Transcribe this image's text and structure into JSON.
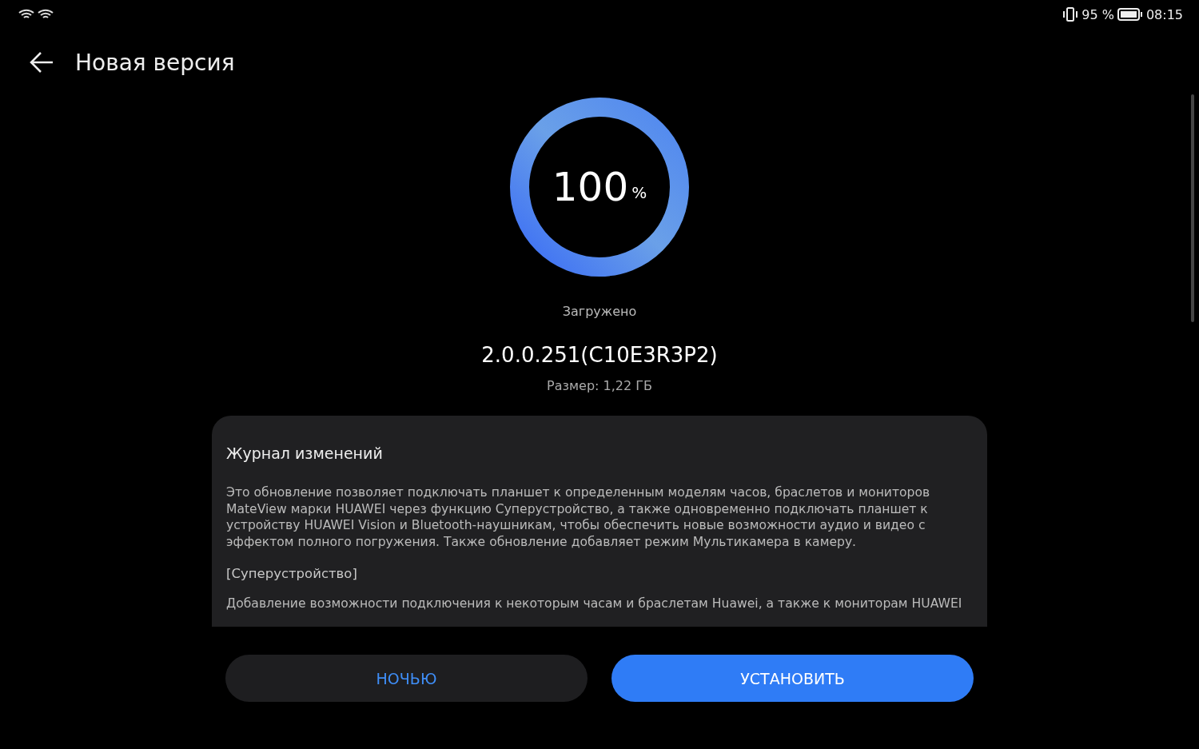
{
  "status_bar": {
    "battery": "95 %",
    "time": "08:15"
  },
  "header": {
    "title": "Новая версия"
  },
  "progress": {
    "level": 1,
    "value": "100",
    "unit": "%",
    "status": "Загружено"
  },
  "version": "2.0.0.251(C10E3R3P2)",
  "size": "Размер: 1,22 ГБ",
  "changelog": {
    "title": "Журнал изменений",
    "paragraphs": [
      {
        "kind": "text",
        "text": "Это обновление позволяет подключать планшет к определенным моделям часов, браслетов и мониторов MateView марки HUAWEI через функцию Суперустройство, а также одновременно подключать планшет к устройству HUAWEI Vision и Bluetooth-наушникам, чтобы обеспечить новые возможности аудио и видео с эффектом полного погружения. Также обновление добавляет режим Мультикамера в камеру."
      },
      {
        "kind": "heading",
        "text": "[Суперустройство]"
      },
      {
        "kind": "text",
        "text": "Добавление возможности подключения к некоторым часам и браслетам Huawei, а также к мониторам HUAWEI"
      }
    ]
  },
  "buttons": [
    {
      "label": "НОЧЬЮ",
      "primary": false
    },
    {
      "label": "УСТАНОВИТЬ",
      "primary": true
    }
  ]
}
